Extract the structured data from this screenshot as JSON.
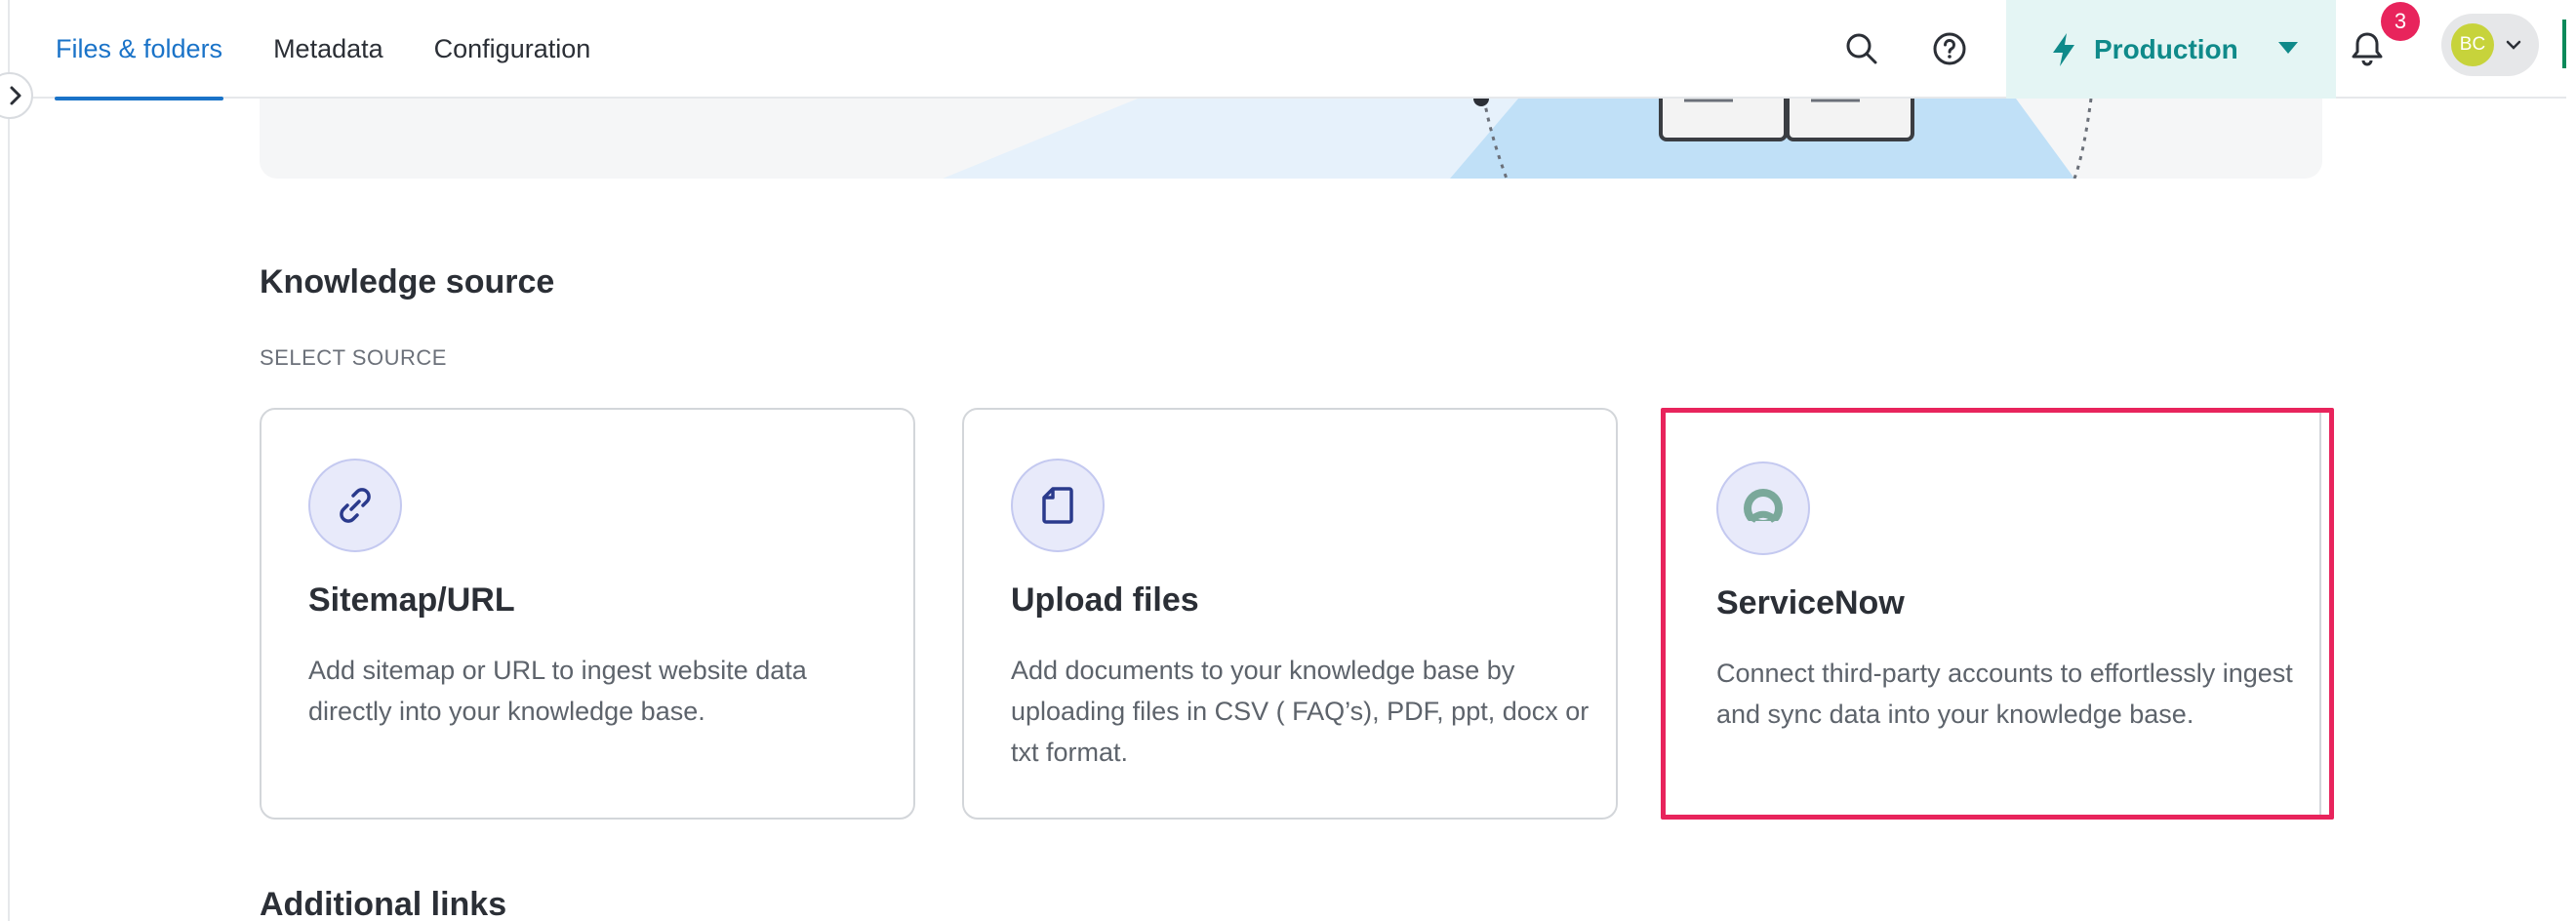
{
  "tabs": [
    {
      "label": "Files & folders"
    },
    {
      "label": "Metadata"
    },
    {
      "label": "Configuration"
    }
  ],
  "environment": {
    "label": "Production"
  },
  "notifications": {
    "count": "3"
  },
  "user": {
    "initials": "BC"
  },
  "knowledge": {
    "title": "Knowledge source",
    "subtitle": "SELECT SOURCE",
    "cards": [
      {
        "title": "Sitemap/URL",
        "description": "Add sitemap or URL to ingest website data directly into your knowledge base.",
        "icon": "link-icon"
      },
      {
        "title": "Upload files",
        "description": "Add documents to your knowledge base by uploading files in CSV ( FAQ’s), PDF, ppt, docx or txt format.",
        "icon": "file-icon"
      },
      {
        "title": "ServiceNow",
        "description": "Connect third-party accounts to effortlessly ingest and sync data into your knowledge base.",
        "icon": "servicenow-icon"
      }
    ]
  },
  "additional": {
    "title": "Additional links"
  },
  "colors": {
    "accent": "#1a73c8",
    "env": "#0f8a8a",
    "highlight": "#e8245c"
  }
}
